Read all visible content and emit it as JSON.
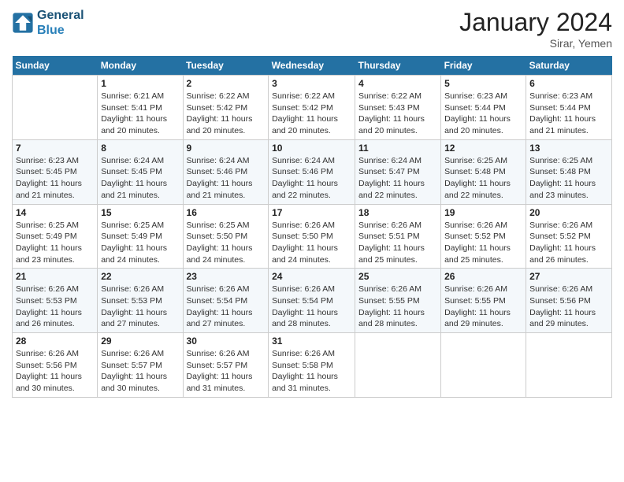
{
  "header": {
    "logo_general": "General",
    "logo_blue": "Blue",
    "month_title": "January 2024",
    "location": "Sirar, Yemen"
  },
  "weekdays": [
    "Sunday",
    "Monday",
    "Tuesday",
    "Wednesday",
    "Thursday",
    "Friday",
    "Saturday"
  ],
  "weeks": [
    [
      {
        "day": "",
        "sunrise": "",
        "sunset": "",
        "daylight": ""
      },
      {
        "day": "1",
        "sunrise": "6:21 AM",
        "sunset": "5:41 PM",
        "daylight": "11 hours and 20 minutes."
      },
      {
        "day": "2",
        "sunrise": "6:22 AM",
        "sunset": "5:42 PM",
        "daylight": "11 hours and 20 minutes."
      },
      {
        "day": "3",
        "sunrise": "6:22 AM",
        "sunset": "5:42 PM",
        "daylight": "11 hours and 20 minutes."
      },
      {
        "day": "4",
        "sunrise": "6:22 AM",
        "sunset": "5:43 PM",
        "daylight": "11 hours and 20 minutes."
      },
      {
        "day": "5",
        "sunrise": "6:23 AM",
        "sunset": "5:44 PM",
        "daylight": "11 hours and 20 minutes."
      },
      {
        "day": "6",
        "sunrise": "6:23 AM",
        "sunset": "5:44 PM",
        "daylight": "11 hours and 21 minutes."
      }
    ],
    [
      {
        "day": "7",
        "sunrise": "6:23 AM",
        "sunset": "5:45 PM",
        "daylight": "11 hours and 21 minutes."
      },
      {
        "day": "8",
        "sunrise": "6:24 AM",
        "sunset": "5:45 PM",
        "daylight": "11 hours and 21 minutes."
      },
      {
        "day": "9",
        "sunrise": "6:24 AM",
        "sunset": "5:46 PM",
        "daylight": "11 hours and 21 minutes."
      },
      {
        "day": "10",
        "sunrise": "6:24 AM",
        "sunset": "5:46 PM",
        "daylight": "11 hours and 22 minutes."
      },
      {
        "day": "11",
        "sunrise": "6:24 AM",
        "sunset": "5:47 PM",
        "daylight": "11 hours and 22 minutes."
      },
      {
        "day": "12",
        "sunrise": "6:25 AM",
        "sunset": "5:48 PM",
        "daylight": "11 hours and 22 minutes."
      },
      {
        "day": "13",
        "sunrise": "6:25 AM",
        "sunset": "5:48 PM",
        "daylight": "11 hours and 23 minutes."
      }
    ],
    [
      {
        "day": "14",
        "sunrise": "6:25 AM",
        "sunset": "5:49 PM",
        "daylight": "11 hours and 23 minutes."
      },
      {
        "day": "15",
        "sunrise": "6:25 AM",
        "sunset": "5:49 PM",
        "daylight": "11 hours and 24 minutes."
      },
      {
        "day": "16",
        "sunrise": "6:25 AM",
        "sunset": "5:50 PM",
        "daylight": "11 hours and 24 minutes."
      },
      {
        "day": "17",
        "sunrise": "6:26 AM",
        "sunset": "5:50 PM",
        "daylight": "11 hours and 24 minutes."
      },
      {
        "day": "18",
        "sunrise": "6:26 AM",
        "sunset": "5:51 PM",
        "daylight": "11 hours and 25 minutes."
      },
      {
        "day": "19",
        "sunrise": "6:26 AM",
        "sunset": "5:52 PM",
        "daylight": "11 hours and 25 minutes."
      },
      {
        "day": "20",
        "sunrise": "6:26 AM",
        "sunset": "5:52 PM",
        "daylight": "11 hours and 26 minutes."
      }
    ],
    [
      {
        "day": "21",
        "sunrise": "6:26 AM",
        "sunset": "5:53 PM",
        "daylight": "11 hours and 26 minutes."
      },
      {
        "day": "22",
        "sunrise": "6:26 AM",
        "sunset": "5:53 PM",
        "daylight": "11 hours and 27 minutes."
      },
      {
        "day": "23",
        "sunrise": "6:26 AM",
        "sunset": "5:54 PM",
        "daylight": "11 hours and 27 minutes."
      },
      {
        "day": "24",
        "sunrise": "6:26 AM",
        "sunset": "5:54 PM",
        "daylight": "11 hours and 28 minutes."
      },
      {
        "day": "25",
        "sunrise": "6:26 AM",
        "sunset": "5:55 PM",
        "daylight": "11 hours and 28 minutes."
      },
      {
        "day": "26",
        "sunrise": "6:26 AM",
        "sunset": "5:55 PM",
        "daylight": "11 hours and 29 minutes."
      },
      {
        "day": "27",
        "sunrise": "6:26 AM",
        "sunset": "5:56 PM",
        "daylight": "11 hours and 29 minutes."
      }
    ],
    [
      {
        "day": "28",
        "sunrise": "6:26 AM",
        "sunset": "5:56 PM",
        "daylight": "11 hours and 30 minutes."
      },
      {
        "day": "29",
        "sunrise": "6:26 AM",
        "sunset": "5:57 PM",
        "daylight": "11 hours and 30 minutes."
      },
      {
        "day": "30",
        "sunrise": "6:26 AM",
        "sunset": "5:57 PM",
        "daylight": "11 hours and 31 minutes."
      },
      {
        "day": "31",
        "sunrise": "6:26 AM",
        "sunset": "5:58 PM",
        "daylight": "11 hours and 31 minutes."
      },
      {
        "day": "",
        "sunrise": "",
        "sunset": "",
        "daylight": ""
      },
      {
        "day": "",
        "sunrise": "",
        "sunset": "",
        "daylight": ""
      },
      {
        "day": "",
        "sunrise": "",
        "sunset": "",
        "daylight": ""
      }
    ]
  ],
  "labels": {
    "sunrise_prefix": "Sunrise: ",
    "sunset_prefix": "Sunset: ",
    "daylight_prefix": "Daylight: "
  }
}
